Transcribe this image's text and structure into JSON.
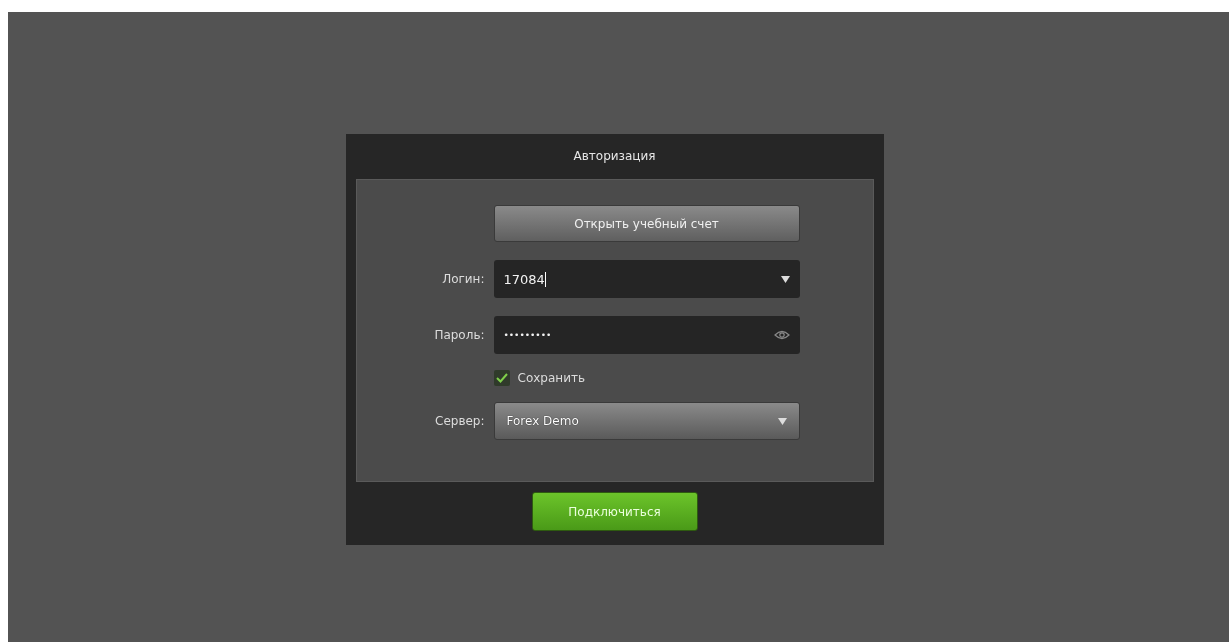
{
  "dialog": {
    "title": "Авторизация",
    "open_demo_button": "Открыть учебный счет",
    "login": {
      "label": "Логин:",
      "value": "17084"
    },
    "password": {
      "label": "Пароль:",
      "value": "•••••••••"
    },
    "save": {
      "label": "Сохранить",
      "checked": true
    },
    "server": {
      "label": "Сервер:",
      "value": "Forex Demo"
    },
    "connect_button": "Подключиться"
  }
}
